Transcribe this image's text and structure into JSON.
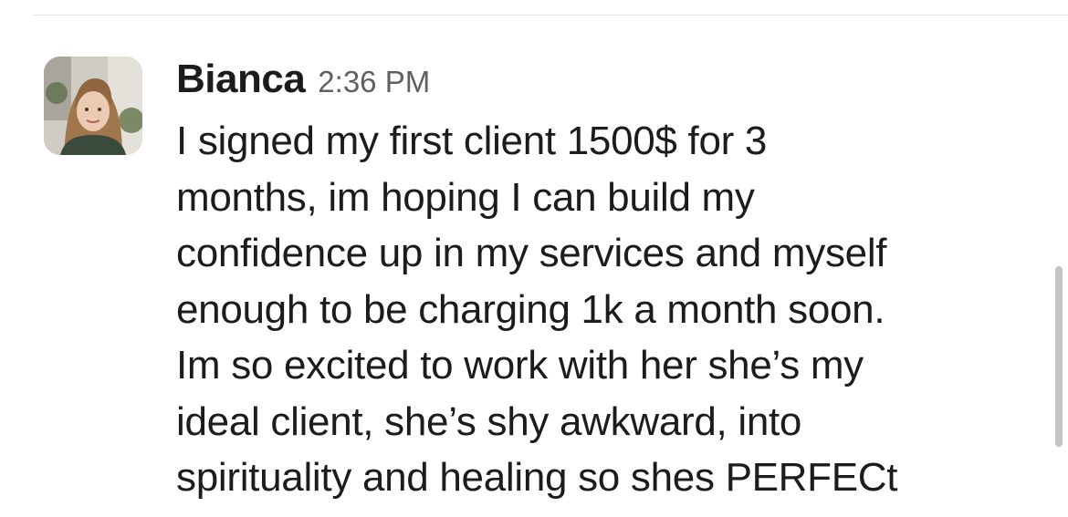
{
  "message": {
    "sender": "Bianca",
    "timestamp": "2:36 PM",
    "lines": [
      "I signed my first client 1500$ for 3",
      "months, im hoping I can build my",
      "confidence up in my services and myself",
      "enough to be charging 1k a month soon.",
      "Im so excited to work with her she’s my",
      "ideal client, she’s shy awkward, into",
      "spirituality and healing so shes PERFECt"
    ],
    "avatar_icon": "user-photo-avatar"
  },
  "colors": {
    "background": "#ffffff",
    "text": "#1d1c1d",
    "timestamp": "#616061",
    "divider": "#e6e6e6",
    "scrollbar": "#c4c4c4"
  }
}
